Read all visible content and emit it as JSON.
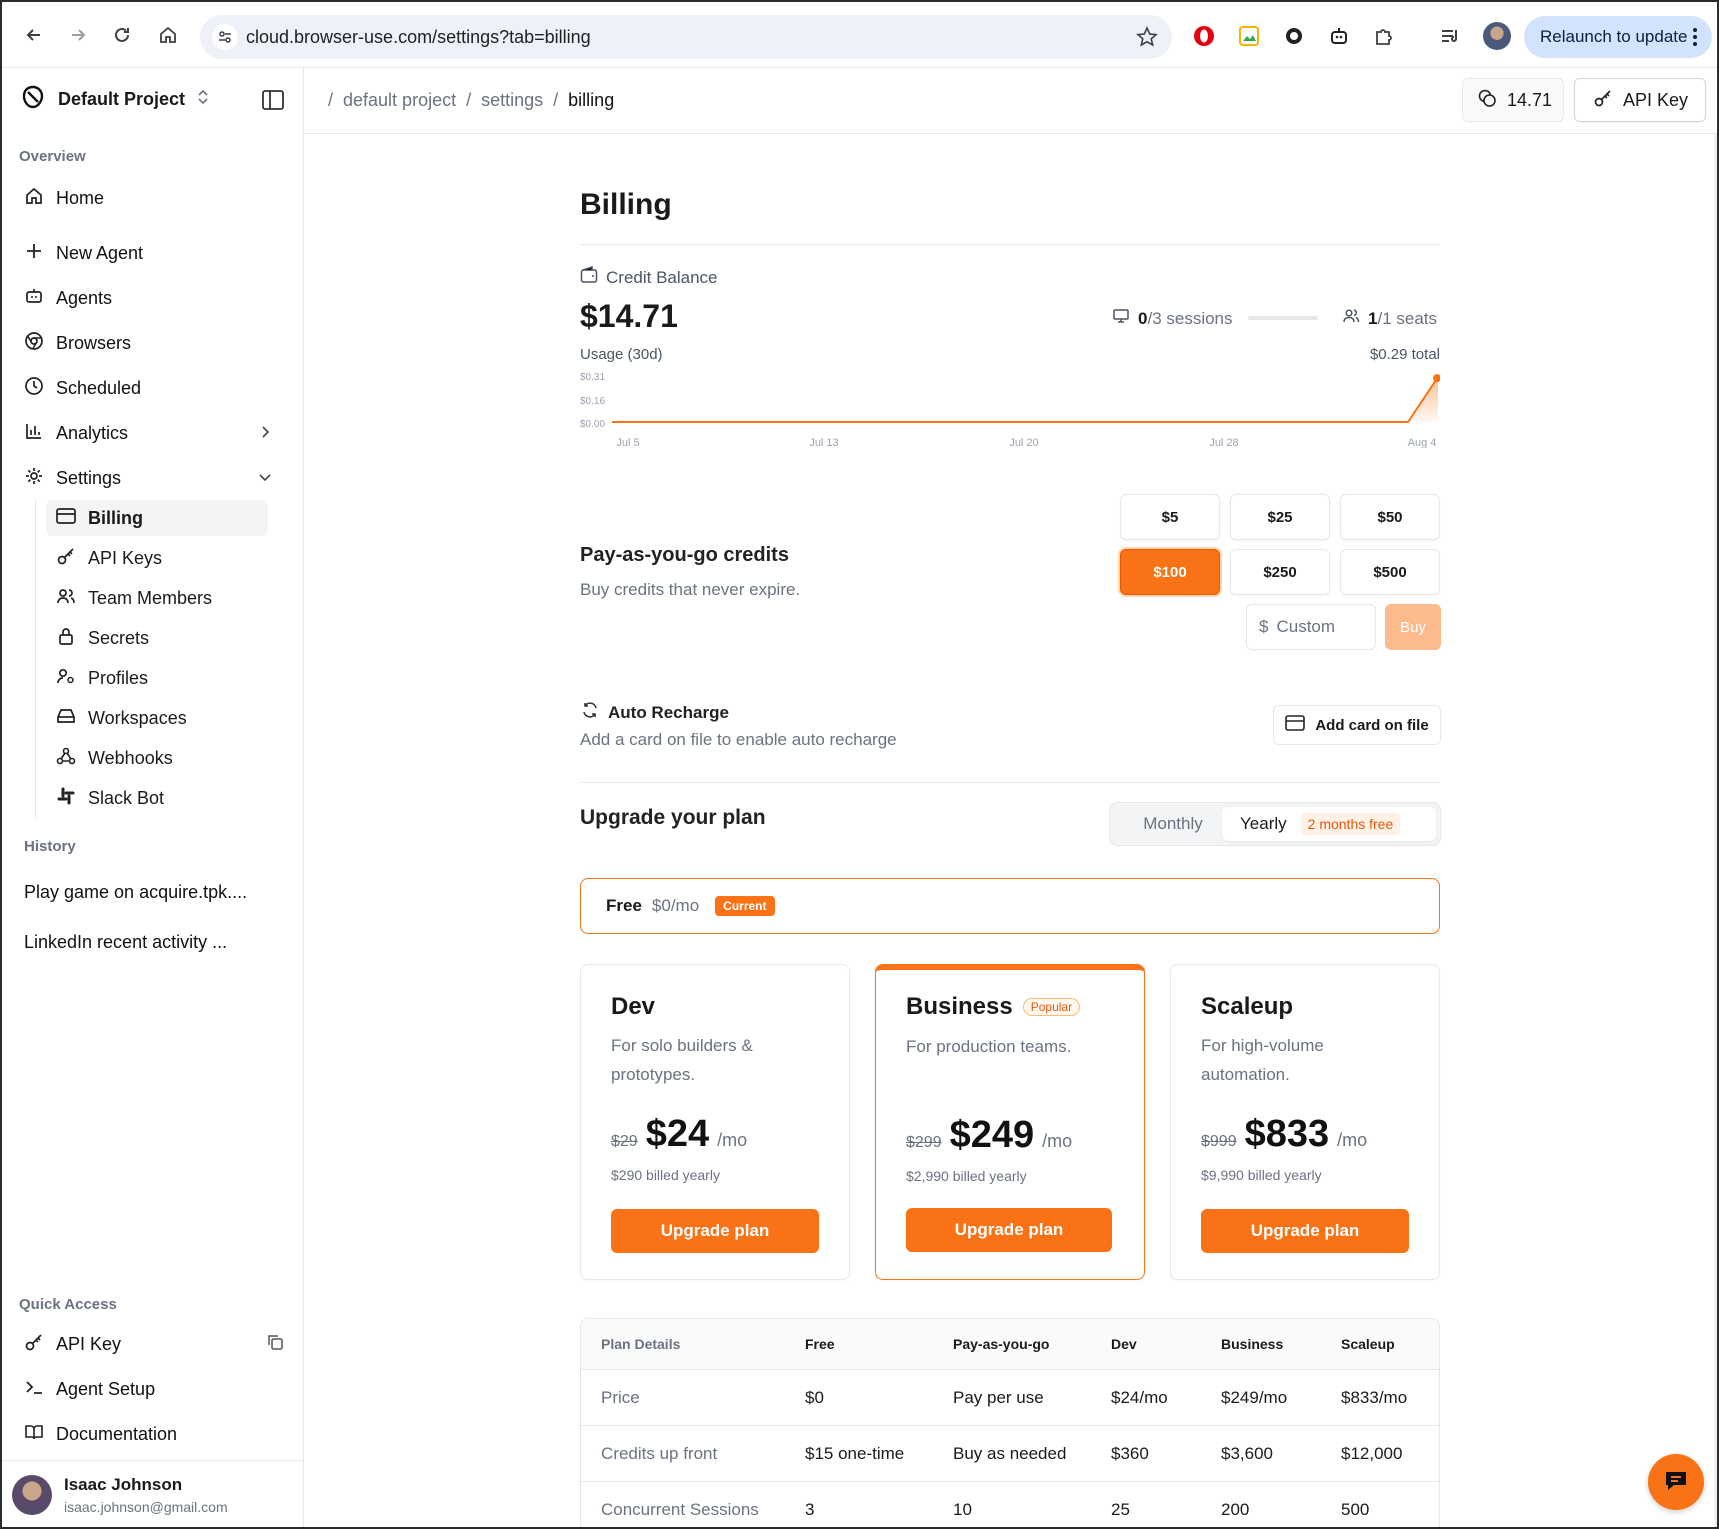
{
  "browser": {
    "url": "cloud.browser-use.com/settings?tab=billing",
    "relaunch_label": "Relaunch to update"
  },
  "sidebar": {
    "project_name": "Default Project",
    "overview_label": "Overview",
    "items": [
      {
        "label": "Home",
        "icon": "home-icon"
      },
      {
        "label": "New Agent",
        "icon": "plus-icon"
      },
      {
        "label": "Agents",
        "icon": "bot-icon"
      },
      {
        "label": "Browsers",
        "icon": "chrome-icon"
      },
      {
        "label": "Scheduled",
        "icon": "clock-icon"
      },
      {
        "label": "Analytics",
        "icon": "bar-chart-icon"
      },
      {
        "label": "Settings",
        "icon": "gear-icon"
      }
    ],
    "settings_items": [
      {
        "label": "Billing",
        "icon": "card-icon"
      },
      {
        "label": "API Keys",
        "icon": "key-icon"
      },
      {
        "label": "Team Members",
        "icon": "users-icon"
      },
      {
        "label": "Secrets",
        "icon": "lock-icon"
      },
      {
        "label": "Profiles",
        "icon": "profile-icon"
      },
      {
        "label": "Workspaces",
        "icon": "drive-icon"
      },
      {
        "label": "Webhooks",
        "icon": "webhook-icon"
      },
      {
        "label": "Slack Bot",
        "icon": "slack-icon"
      }
    ],
    "history_label": "History",
    "history": [
      "Play game on acquire.tpk....",
      "LinkedIn recent activity ..."
    ],
    "quick_access_label": "Quick Access",
    "quick_access": [
      {
        "label": "API Key",
        "icon": "key-icon"
      },
      {
        "label": "Agent Setup",
        "icon": "terminal-icon"
      },
      {
        "label": "Documentation",
        "icon": "book-icon"
      }
    ],
    "user": {
      "name": "Isaac Johnson",
      "email": "isaac.johnson@gmail.com"
    }
  },
  "header": {
    "breadcrumb": [
      "default project",
      "settings",
      "billing"
    ],
    "credits": "14.71",
    "api_key_label": "API Key"
  },
  "billing": {
    "title": "Billing",
    "credit_balance_label": "Credit Balance",
    "balance": "$14.71",
    "sessions_used": "0",
    "sessions_total": "/3 sessions",
    "seats_used": "1",
    "seats_total": "/1 seats",
    "usage_label": "Usage (30d)",
    "usage_total": "$0.29 total",
    "payg_title": "Pay-as-you-go credits",
    "payg_sub": "Buy credits that never expire.",
    "amounts": [
      "$5",
      "$25",
      "$50",
      "$100",
      "$250",
      "$500"
    ],
    "selected_amount": "$100",
    "custom_placeholder": "Custom",
    "currency_symbol": "$",
    "buy_label": "Buy",
    "auto_recharge_title": "Auto Recharge",
    "auto_recharge_sub": "Add a card on file to enable auto recharge",
    "add_card_label": "Add card on file",
    "upgrade_title": "Upgrade your plan",
    "toggle": {
      "monthly": "Monthly",
      "yearly": "Yearly",
      "yearly_badge": "2 months free",
      "selected": "Yearly"
    },
    "free_plan": {
      "name": "Free",
      "price": "$0/mo",
      "badge": "Current"
    },
    "plans": [
      {
        "name": "Dev",
        "desc": "For solo builders & prototypes.",
        "old_price": "$29",
        "price": "$24",
        "per": "/mo",
        "billed": "$290 billed yearly",
        "cta": "Upgrade plan"
      },
      {
        "name": "Business",
        "badge": "Popular",
        "desc": "For production teams.",
        "old_price": "$299",
        "price": "$249",
        "per": "/mo",
        "billed": "$2,990 billed yearly",
        "cta": "Upgrade plan"
      },
      {
        "name": "Scaleup",
        "desc": "For high-volume automation.",
        "old_price": "$999",
        "price": "$833",
        "per": "/mo",
        "billed": "$9,990 billed yearly",
        "cta": "Upgrade plan"
      }
    ],
    "table": {
      "headers": [
        "Plan Details",
        "Free",
        "Pay-as-you-go",
        "Dev",
        "Business",
        "Scaleup"
      ],
      "rows": [
        [
          "Price",
          "$0",
          "Pay per use",
          "$24/mo",
          "$249/mo",
          "$833/mo"
        ],
        [
          "Credits up front",
          "$15 one-time",
          "Buy as needed",
          "$360",
          "$3,600",
          "$12,000"
        ],
        [
          "Concurrent Sessions",
          "3",
          "10",
          "25",
          "200",
          "500"
        ]
      ]
    }
  },
  "chart_data": {
    "type": "area",
    "title": "",
    "xlabel": "",
    "ylabel": "",
    "y_ticks": [
      "$0.31",
      "$0.16",
      "$0.00"
    ],
    "x_ticks": [
      "Jul 5",
      "Jul 13",
      "Jul 20",
      "Jul 28",
      "Aug 4"
    ],
    "ylim": [
      0,
      0.31
    ],
    "x": [
      "Jul 5",
      "Aug 3",
      "Aug 4"
    ],
    "values": [
      0,
      0,
      0.29
    ],
    "color": "#f97316"
  },
  "colors": {
    "accent": "#f97316",
    "accent_light": "#fdba8c"
  }
}
